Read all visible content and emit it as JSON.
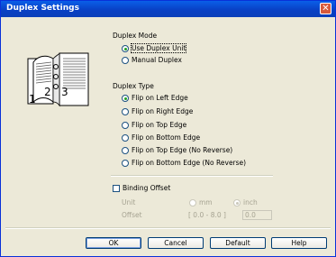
{
  "window": {
    "title": "Duplex Settings",
    "close_glyph": "✕"
  },
  "duplex_mode": {
    "heading": "Duplex Mode",
    "options": [
      {
        "label": "Use Duplex Unit",
        "selected": true
      },
      {
        "label": "Manual Duplex",
        "selected": false
      }
    ]
  },
  "preview": {
    "page_numbers": [
      "1",
      "2",
      "3"
    ]
  },
  "duplex_type": {
    "heading": "Duplex Type",
    "options": [
      {
        "label": "Flip on Left Edge",
        "selected": true
      },
      {
        "label": "Flip on Right Edge",
        "selected": false
      },
      {
        "label": "Flip on Top Edge",
        "selected": false
      },
      {
        "label": "Flip on Bottom Edge",
        "selected": false
      },
      {
        "label": "Flip on Top Edge (No Reverse)",
        "selected": false
      },
      {
        "label": "Flip on Bottom Edge (No Reverse)",
        "selected": false
      }
    ]
  },
  "binding_offset": {
    "label": "Binding Offset",
    "checked": false,
    "unit_label": "Unit",
    "unit_options": [
      {
        "label": "mm",
        "selected": false
      },
      {
        "label": "inch",
        "selected": true
      }
    ],
    "offset_label": "Offset",
    "range": "[ 0.0 - 8.0 ]",
    "value": "0.0"
  },
  "buttons": {
    "ok": "OK",
    "cancel": "Cancel",
    "default": "Default",
    "help": "Help"
  },
  "colors": {
    "titlebar": "#0a5fe8",
    "dialog_bg": "#ece9d8",
    "close": "#d75a3c",
    "radio_dot": "#21a121"
  }
}
